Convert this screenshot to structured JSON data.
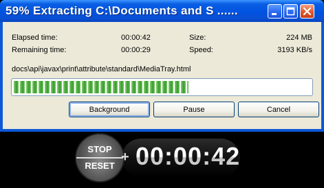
{
  "window": {
    "title": "59% Extracting C:\\Documents and S ......",
    "buttons": {
      "minimize": "minimize",
      "maximize": "maximize",
      "close": "close"
    }
  },
  "stats": {
    "elapsed_label": "Elapsed time:",
    "elapsed_value": "00:00:42",
    "remaining_label": "Remaining time:",
    "remaining_value": "00:00:29",
    "size_label": "Size:",
    "size_value": "224 MB",
    "speed_label": "Speed:",
    "speed_value": "3193 KB/s"
  },
  "current_file": "docs\\api\\javax\\print\\attribute\\standard\\MediaTray.html",
  "progress": {
    "percent": 59
  },
  "actions": {
    "background": "Background",
    "pause": "Pause",
    "cancel": "Cancel"
  },
  "stopwatch": {
    "stop_label": "STOP",
    "reset_label": "RESET",
    "plus": "+",
    "time": "00:00:42"
  },
  "colors": {
    "titlebar": "#0053e1",
    "client_bg": "#ece9d8",
    "progress_fill": "#5ab64a",
    "close_button": "#e2562c"
  }
}
